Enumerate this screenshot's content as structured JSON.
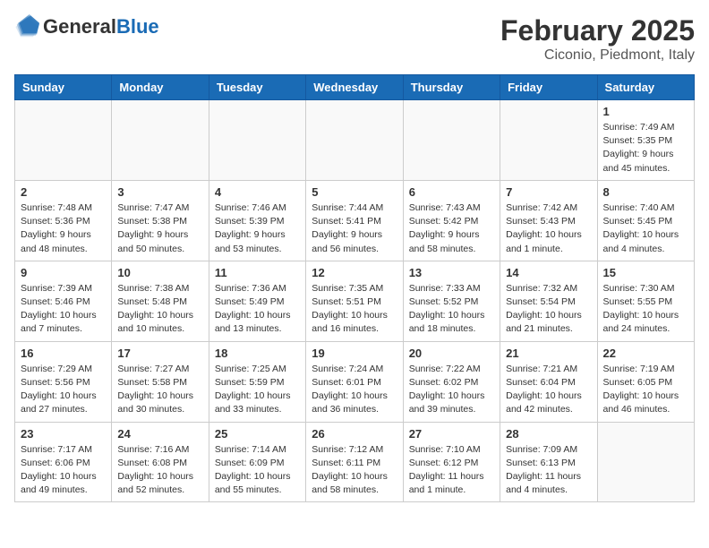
{
  "header": {
    "logo_general": "General",
    "logo_blue": "Blue",
    "month_title": "February 2025",
    "location": "Ciconio, Piedmont, Italy"
  },
  "weekdays": [
    "Sunday",
    "Monday",
    "Tuesday",
    "Wednesday",
    "Thursday",
    "Friday",
    "Saturday"
  ],
  "weeks": [
    [
      {
        "day": "",
        "info": ""
      },
      {
        "day": "",
        "info": ""
      },
      {
        "day": "",
        "info": ""
      },
      {
        "day": "",
        "info": ""
      },
      {
        "day": "",
        "info": ""
      },
      {
        "day": "",
        "info": ""
      },
      {
        "day": "1",
        "info": "Sunrise: 7:49 AM\nSunset: 5:35 PM\nDaylight: 9 hours and 45 minutes."
      }
    ],
    [
      {
        "day": "2",
        "info": "Sunrise: 7:48 AM\nSunset: 5:36 PM\nDaylight: 9 hours and 48 minutes."
      },
      {
        "day": "3",
        "info": "Sunrise: 7:47 AM\nSunset: 5:38 PM\nDaylight: 9 hours and 50 minutes."
      },
      {
        "day": "4",
        "info": "Sunrise: 7:46 AM\nSunset: 5:39 PM\nDaylight: 9 hours and 53 minutes."
      },
      {
        "day": "5",
        "info": "Sunrise: 7:44 AM\nSunset: 5:41 PM\nDaylight: 9 hours and 56 minutes."
      },
      {
        "day": "6",
        "info": "Sunrise: 7:43 AM\nSunset: 5:42 PM\nDaylight: 9 hours and 58 minutes."
      },
      {
        "day": "7",
        "info": "Sunrise: 7:42 AM\nSunset: 5:43 PM\nDaylight: 10 hours and 1 minute."
      },
      {
        "day": "8",
        "info": "Sunrise: 7:40 AM\nSunset: 5:45 PM\nDaylight: 10 hours and 4 minutes."
      }
    ],
    [
      {
        "day": "9",
        "info": "Sunrise: 7:39 AM\nSunset: 5:46 PM\nDaylight: 10 hours and 7 minutes."
      },
      {
        "day": "10",
        "info": "Sunrise: 7:38 AM\nSunset: 5:48 PM\nDaylight: 10 hours and 10 minutes."
      },
      {
        "day": "11",
        "info": "Sunrise: 7:36 AM\nSunset: 5:49 PM\nDaylight: 10 hours and 13 minutes."
      },
      {
        "day": "12",
        "info": "Sunrise: 7:35 AM\nSunset: 5:51 PM\nDaylight: 10 hours and 16 minutes."
      },
      {
        "day": "13",
        "info": "Sunrise: 7:33 AM\nSunset: 5:52 PM\nDaylight: 10 hours and 18 minutes."
      },
      {
        "day": "14",
        "info": "Sunrise: 7:32 AM\nSunset: 5:54 PM\nDaylight: 10 hours and 21 minutes."
      },
      {
        "day": "15",
        "info": "Sunrise: 7:30 AM\nSunset: 5:55 PM\nDaylight: 10 hours and 24 minutes."
      }
    ],
    [
      {
        "day": "16",
        "info": "Sunrise: 7:29 AM\nSunset: 5:56 PM\nDaylight: 10 hours and 27 minutes."
      },
      {
        "day": "17",
        "info": "Sunrise: 7:27 AM\nSunset: 5:58 PM\nDaylight: 10 hours and 30 minutes."
      },
      {
        "day": "18",
        "info": "Sunrise: 7:25 AM\nSunset: 5:59 PM\nDaylight: 10 hours and 33 minutes."
      },
      {
        "day": "19",
        "info": "Sunrise: 7:24 AM\nSunset: 6:01 PM\nDaylight: 10 hours and 36 minutes."
      },
      {
        "day": "20",
        "info": "Sunrise: 7:22 AM\nSunset: 6:02 PM\nDaylight: 10 hours and 39 minutes."
      },
      {
        "day": "21",
        "info": "Sunrise: 7:21 AM\nSunset: 6:04 PM\nDaylight: 10 hours and 42 minutes."
      },
      {
        "day": "22",
        "info": "Sunrise: 7:19 AM\nSunset: 6:05 PM\nDaylight: 10 hours and 46 minutes."
      }
    ],
    [
      {
        "day": "23",
        "info": "Sunrise: 7:17 AM\nSunset: 6:06 PM\nDaylight: 10 hours and 49 minutes."
      },
      {
        "day": "24",
        "info": "Sunrise: 7:16 AM\nSunset: 6:08 PM\nDaylight: 10 hours and 52 minutes."
      },
      {
        "day": "25",
        "info": "Sunrise: 7:14 AM\nSunset: 6:09 PM\nDaylight: 10 hours and 55 minutes."
      },
      {
        "day": "26",
        "info": "Sunrise: 7:12 AM\nSunset: 6:11 PM\nDaylight: 10 hours and 58 minutes."
      },
      {
        "day": "27",
        "info": "Sunrise: 7:10 AM\nSunset: 6:12 PM\nDaylight: 11 hours and 1 minute."
      },
      {
        "day": "28",
        "info": "Sunrise: 7:09 AM\nSunset: 6:13 PM\nDaylight: 11 hours and 4 minutes."
      },
      {
        "day": "",
        "info": ""
      }
    ]
  ]
}
